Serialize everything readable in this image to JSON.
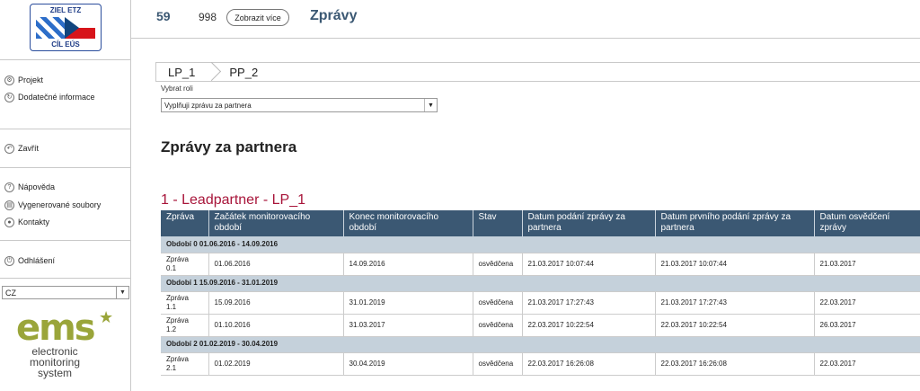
{
  "logo": {
    "top_text": "ZIEL ETZ",
    "bottom_text": "CÍL EÚS"
  },
  "sidebar": {
    "items": [
      {
        "label": "Projekt",
        "icon": "gear-icon"
      },
      {
        "label": "Dodatečné informace",
        "icon": "refresh-icon"
      },
      {
        "label": "Zavřít",
        "icon": "back-icon"
      },
      {
        "label": "Nápověda",
        "icon": "help-icon"
      },
      {
        "label": "Vygenerované soubory",
        "icon": "file-icon"
      },
      {
        "label": "Kontakty",
        "icon": "user-icon"
      },
      {
        "label": "Odhlášení",
        "icon": "power-icon"
      }
    ],
    "language": "CZ"
  },
  "ems": {
    "mark": "ems",
    "line1": "electronic",
    "line2": "monitoring",
    "line3": "system"
  },
  "header": {
    "num1": "59",
    "num2": "998",
    "show_more": "Zobrazit více",
    "title": "Zprávy"
  },
  "breadcrumb": [
    "LP_1",
    "PP_2"
  ],
  "role": {
    "label": "Vybrat roli",
    "value": "Vyplňuji zprávu za partnera"
  },
  "section_title": "Zprávy za partnera",
  "partner_title": "1 - Leadpartner - LP_1",
  "table": {
    "headers": [
      "Zpráva",
      "Začátek monitorovacího období",
      "Konec monitorovacího období",
      "Stav",
      "Datum podání zprávy za partnera",
      "Datum prvního podání zprávy za partnera",
      "Datum osvědčení zprávy"
    ],
    "groups": [
      {
        "period": "Období 0 01.06.2016 - 14.09.2016",
        "rows": [
          {
            "report_l1": "Zpráva",
            "report_l2": "0.1",
            "start": "01.06.2016",
            "end": "14.09.2016",
            "status": "osvědčena",
            "submitted": "21.03.2017 10:07:44",
            "first_submitted": "21.03.2017 10:07:44",
            "certified": "21.03.2017"
          }
        ]
      },
      {
        "period": "Období 1 15.09.2016 - 31.01.2019",
        "rows": [
          {
            "report_l1": "Zpráva",
            "report_l2": "1.1",
            "start": "15.09.2016",
            "end": "31.01.2019",
            "status": "osvědčena",
            "submitted": "21.03.2017 17:27:43",
            "first_submitted": "21.03.2017 17:27:43",
            "certified": "22.03.2017"
          },
          {
            "report_l1": "Zpráva",
            "report_l2": "1.2",
            "start": "01.10.2016",
            "end": "31.03.2017",
            "status": "osvědčena",
            "submitted": "22.03.2017 10:22:54",
            "first_submitted": "22.03.2017 10:22:54",
            "certified": "26.03.2017"
          }
        ]
      },
      {
        "period": "Období 2 01.02.2019 - 30.04.2019",
        "rows": [
          {
            "report_l1": "Zpráva",
            "report_l2": "2.1",
            "start": "01.02.2019",
            "end": "30.04.2019",
            "status": "osvědčena",
            "submitted": "22.03.2017 16:26:08",
            "first_submitted": "22.03.2017 16:26:08",
            "certified": "22.03.2017"
          }
        ]
      }
    ]
  }
}
